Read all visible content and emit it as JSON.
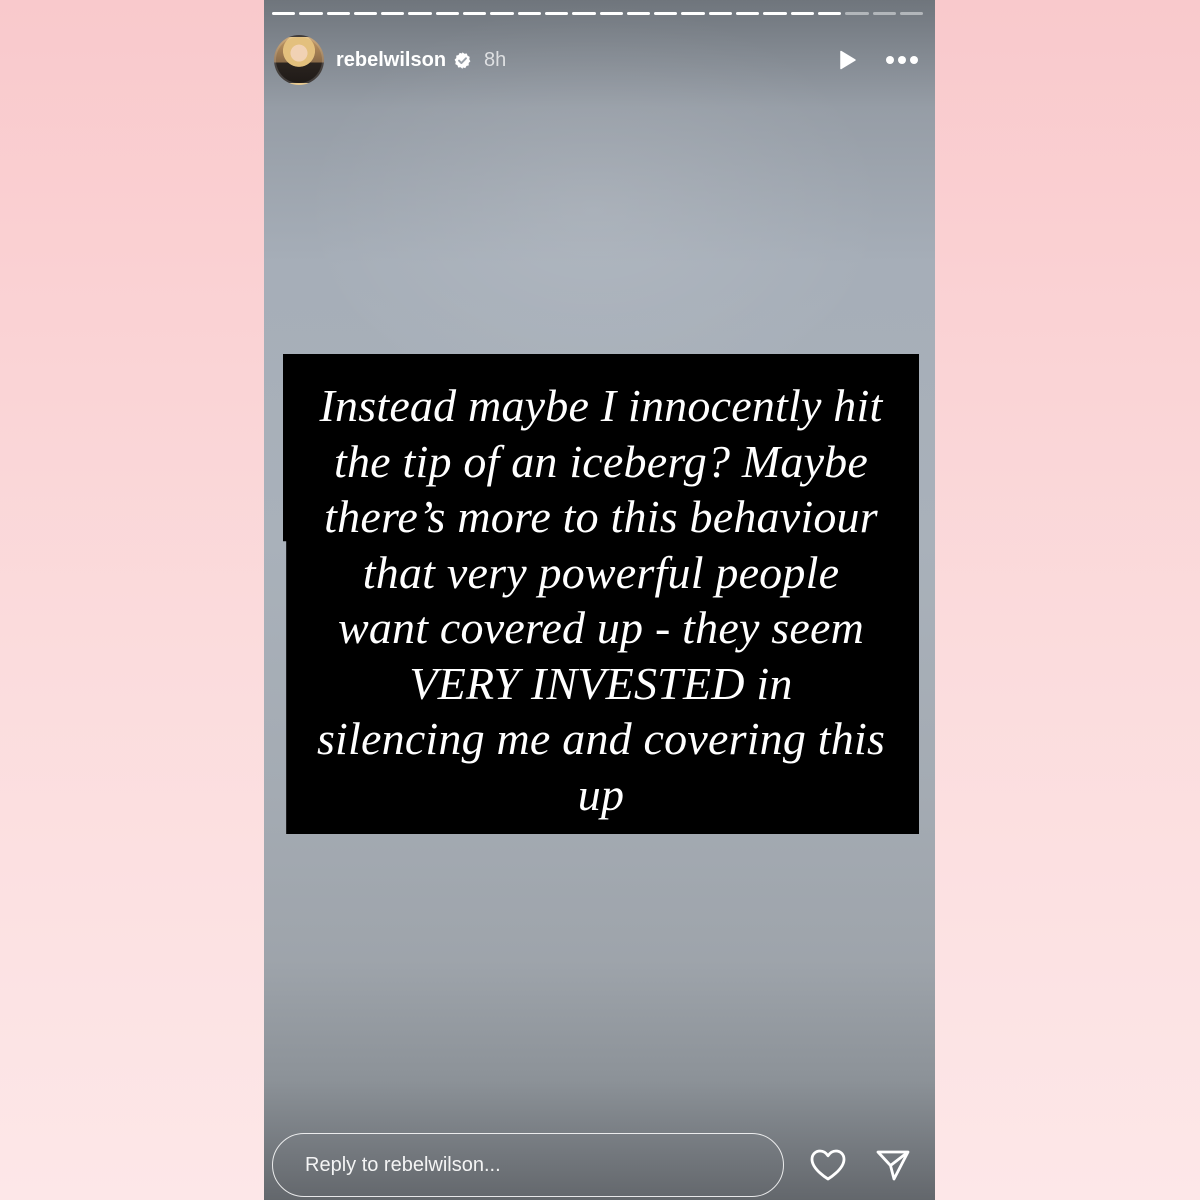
{
  "story": {
    "progress": {
      "total_segments": 24,
      "completed_segments": 21
    },
    "header": {
      "username": "rebelwilson",
      "verified_icon": "verified-badge-icon",
      "time": "8h",
      "play_icon": "play-icon",
      "more_icon": "more-horizontal-icon"
    },
    "text_lines": [
      "Instead maybe I innocently hit",
      "the tip of an iceberg? Maybe",
      "there’s more to this behaviour",
      "that very powerful people",
      "want covered up - they seem",
      "VERY INVESTED in",
      "silencing me and covering this",
      "up"
    ],
    "footer": {
      "reply_placeholder": "Reply to rebelwilson...",
      "like_icon": "heart-icon",
      "share_icon": "send-icon"
    }
  },
  "colors": {
    "page_background_top": "#f9c9cc",
    "page_background_bottom": "#fde7e8",
    "text_box": "#000000",
    "text": "#ffffff"
  }
}
